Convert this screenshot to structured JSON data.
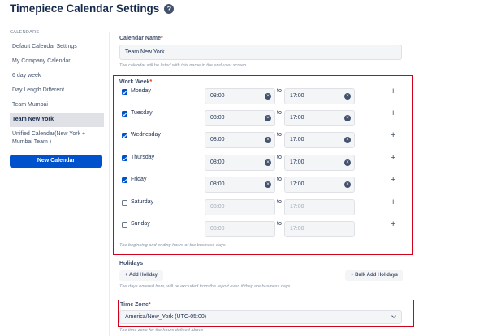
{
  "header": {
    "title": "Timepiece Calendar Settings",
    "help_icon": "?"
  },
  "sidebar": {
    "heading": "CALENDARS",
    "items": [
      {
        "label": "Default Calendar Settings"
      },
      {
        "label": "My Company Calendar"
      },
      {
        "label": "6 day week"
      },
      {
        "label": "Day Length Different"
      },
      {
        "label": "Team Mumbai"
      },
      {
        "label": "Team New York",
        "active": true
      },
      {
        "label": "Unified Calendar(New York + Mumbai Team )"
      }
    ],
    "new_button": "New Calendar"
  },
  "form": {
    "calendar_name": {
      "label": "Calendar Name",
      "required": "*",
      "value": "Team New York",
      "help": "The calendar will be listed with this name in the end-user screen"
    },
    "work_week": {
      "label": "Work Week",
      "required": "*",
      "to_word": "to",
      "add_symbol": "+",
      "clear_symbol": "×",
      "days": [
        {
          "name": "Monday",
          "checked": true,
          "from": "08:00",
          "to": "17:00"
        },
        {
          "name": "Tuesday",
          "checked": true,
          "from": "08:00",
          "to": "17:00"
        },
        {
          "name": "Wednesday",
          "checked": true,
          "from": "08:00",
          "to": "17:00"
        },
        {
          "name": "Thursday",
          "checked": true,
          "from": "08:00",
          "to": "17:00"
        },
        {
          "name": "Friday",
          "checked": true,
          "from": "08:00",
          "to": "17:00"
        },
        {
          "name": "Saturday",
          "checked": false,
          "from": "08:00",
          "to": "17:00"
        },
        {
          "name": "Sunday",
          "checked": false,
          "from": "08:00",
          "to": "17:00"
        }
      ],
      "help": "The beginning and ending hours of the business days"
    },
    "holidays": {
      "label": "Holidays",
      "add_button": "+ Add Holiday",
      "bulk_button": "+ Bulk Add Holidays",
      "help": "The days entered here, will be excluded from the report even if they are business days"
    },
    "time_zone": {
      "label": "Time Zone",
      "required": "*",
      "value": "America/New_York (UTC-05:00)",
      "help": "The time zone for the hours defined above"
    }
  },
  "colors": {
    "accent": "#0052cc",
    "highlight": "#d0021b",
    "sidebar_active": "#dfe1e6"
  }
}
